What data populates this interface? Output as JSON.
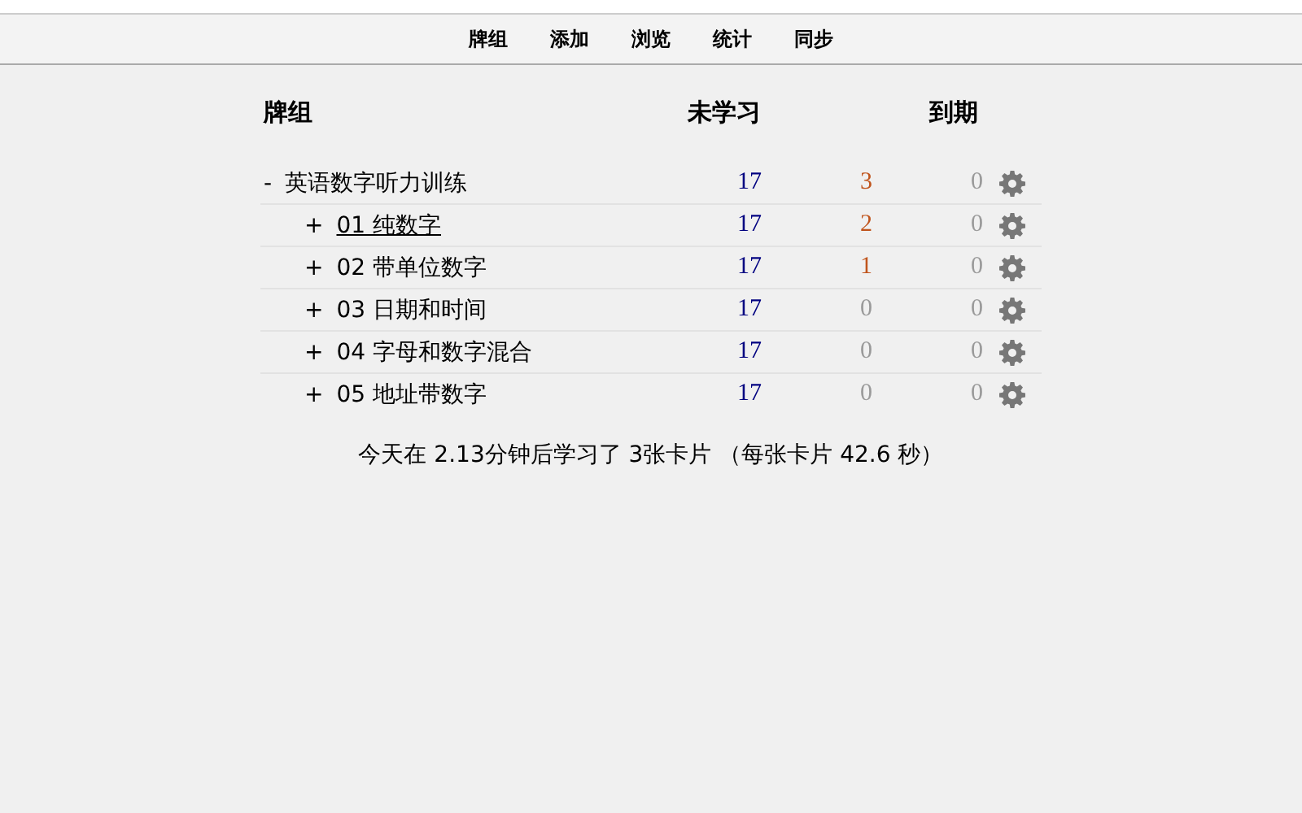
{
  "toolbar": {
    "items": [
      {
        "label": "牌组"
      },
      {
        "label": "添加"
      },
      {
        "label": "浏览"
      },
      {
        "label": "统计"
      },
      {
        "label": "同步"
      }
    ]
  },
  "deck_table": {
    "columns": [
      "牌组",
      "未学习",
      "到期"
    ],
    "decks": [
      {
        "toggle": "-",
        "name": "英语数字听力训练",
        "hovered": false,
        "new": "17",
        "learn": {
          "text": "3",
          "dimmed": false
        },
        "due": {
          "text": "0",
          "dimmed": true
        },
        "children": [
          {
            "toggle": "+",
            "name": "01 纯数字",
            "hovered": true,
            "new": "17",
            "learn": {
              "text": "2",
              "dimmed": false
            },
            "due": {
              "text": "0",
              "dimmed": true
            }
          },
          {
            "toggle": "+",
            "name": "02 带单位数字",
            "hovered": false,
            "new": "17",
            "learn": {
              "text": "1",
              "dimmed": false
            },
            "due": {
              "text": "0",
              "dimmed": true
            }
          },
          {
            "toggle": "+",
            "name": "03 日期和时间",
            "hovered": false,
            "new": "17",
            "learn": {
              "text": "0",
              "dimmed": true
            },
            "due": {
              "text": "0",
              "dimmed": true
            }
          },
          {
            "toggle": "+",
            "name": "04 字母和数字混合",
            "hovered": false,
            "new": "17",
            "learn": {
              "text": "0",
              "dimmed": true
            },
            "due": {
              "text": "0",
              "dimmed": true
            }
          },
          {
            "toggle": "+",
            "name": "05 地址带数字",
            "hovered": false,
            "new": "17",
            "learn": {
              "text": "0",
              "dimmed": true
            },
            "due": {
              "text": "0",
              "dimmed": true
            }
          }
        ]
      }
    ]
  },
  "summary": "今天在 2.13分钟后学习了 3张卡片 （每张卡片 42.6 秒）"
}
